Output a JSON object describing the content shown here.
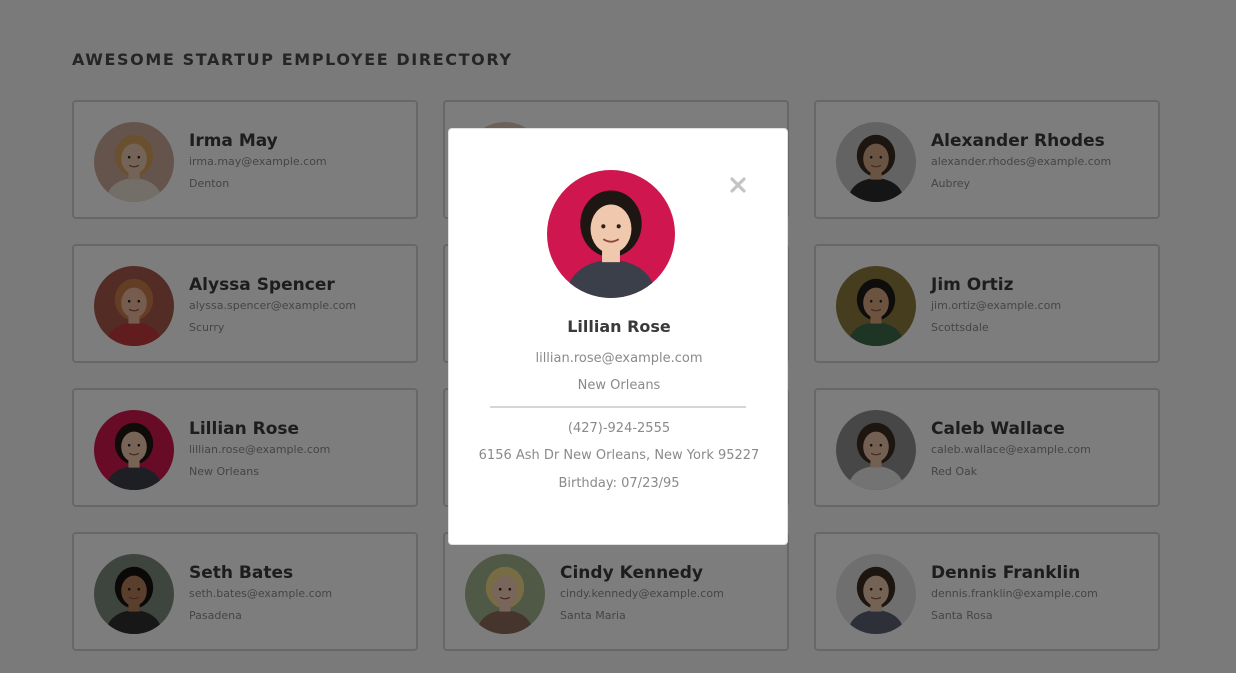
{
  "header": {
    "title": "AWESOME STARTUP EMPLOYEE DIRECTORY"
  },
  "employees": [
    {
      "name": "Irma May",
      "email": "irma.may@example.com",
      "city": "Denton",
      "bg": "#c8a898",
      "skin": "#e9c7ae",
      "hair": "#d4a15c",
      "shirt": "#e8ddd0"
    },
    {
      "name": "",
      "email": "",
      "city": "",
      "bg": "#d8c2b0",
      "skin": "#e2bfa3",
      "hair": "#b07f5a",
      "shirt": "#cfc6bc"
    },
    {
      "name": "Alexander Rhodes",
      "email": "alexander.rhodes@example.com",
      "city": "Aubrey",
      "bg": "#c7c7c7",
      "skin": "#d2a988",
      "hair": "#3b2c20",
      "shirt": "#2b2b2b"
    },
    {
      "name": "Alyssa Spencer",
      "email": "alyssa.spencer@example.com",
      "city": "Scurry",
      "bg": "#a65a4a",
      "skin": "#eab99c",
      "hair": "#c87a4a",
      "shirt": "#c23a3a"
    },
    {
      "name": "",
      "email": "",
      "city": "",
      "bg": "#d0d0d0",
      "skin": "#e2bfa3",
      "hair": "#6a4a33",
      "shirt": "#9aa7b5"
    },
    {
      "name": "Jim Ortiz",
      "email": "jim.ortiz@example.com",
      "city": "Scottsdale",
      "bg": "#8a7a3a",
      "skin": "#d7a77f",
      "hair": "#1e1a17",
      "shirt": "#3d6b4a"
    },
    {
      "name": "Lillian Rose",
      "email": "lillian.rose@example.com",
      "city": "New Orleans",
      "bg": "#d0164f",
      "skin": "#efc8ad",
      "hair": "#1d1613",
      "shirt": "#3b3f4a"
    },
    {
      "name": "",
      "email": "",
      "city": "",
      "bg": "#cfcfcf",
      "skin": "#e2bfa3",
      "hair": "#4b3626",
      "shirt": "#8a8a8a"
    },
    {
      "name": "Caleb Wallace",
      "email": "caleb.wallace@example.com",
      "city": "Red Oak",
      "bg": "#8f8f8f",
      "skin": "#e8c1a4",
      "hair": "#3b2a1f",
      "shirt": "#e6e6e6"
    },
    {
      "name": "Seth Bates",
      "email": "seth.bates@example.com",
      "city": "Pasadena",
      "bg": "#7c8a7c",
      "skin": "#b57f58",
      "hair": "#151210",
      "shirt": "#2e2e2e"
    },
    {
      "name": "Cindy Kennedy",
      "email": "cindy.kennedy@example.com",
      "city": "Santa Maria",
      "bg": "#9fb38a",
      "skin": "#f0cdb6",
      "hair": "#f0d88a",
      "shirt": "#8a6a58"
    },
    {
      "name": "Dennis Franklin",
      "email": "dennis.franklin@example.com",
      "city": "Santa Rosa",
      "bg": "#dedede",
      "skin": "#e8c4a8",
      "hair": "#3a2a1e",
      "shirt": "#5a6070"
    }
  ],
  "modal": {
    "name": "Lillian Rose",
    "email": "lillian.rose@example.com",
    "city": "New Orleans",
    "phone": "(427)-924-2555",
    "address": "6156 Ash Dr New Orleans, New York 95227",
    "birthday": "Birthday: 07/23/95",
    "close_icon": "close-icon",
    "avatar": {
      "bg": "#d0164f",
      "skin": "#efc8ad",
      "hair": "#1d1613",
      "shirt": "#3b3f4a"
    }
  }
}
